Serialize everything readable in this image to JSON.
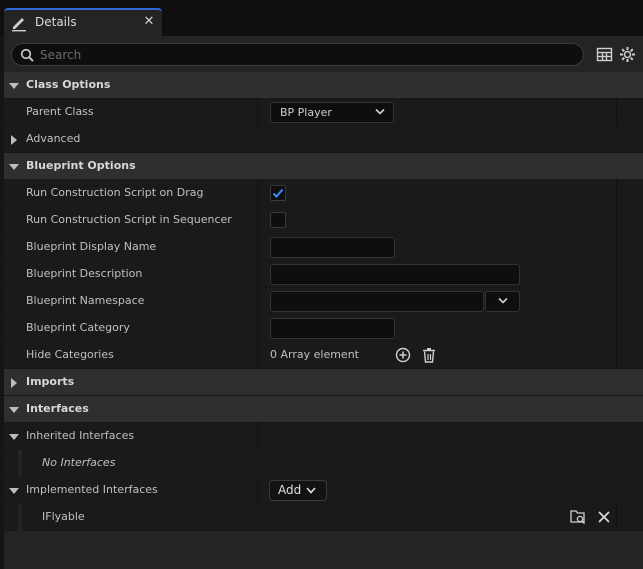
{
  "tab": {
    "title": "Details",
    "close": "✕"
  },
  "search": {
    "placeholder": "Search"
  },
  "sections": {
    "class_options": {
      "label": "Class Options"
    },
    "parent_class": {
      "label": "Parent Class",
      "value": "BP Player"
    },
    "advanced": {
      "label": "Advanced"
    },
    "blueprint_options": {
      "label": "Blueprint Options"
    },
    "run_construction_drag": {
      "label": "Run Construction Script on Drag",
      "checked": true
    },
    "run_construction_sequencer": {
      "label": "Run Construction Script in Sequencer",
      "checked": false
    },
    "display_name": {
      "label": "Blueprint Display Name",
      "value": ""
    },
    "description": {
      "label": "Blueprint Description",
      "value": ""
    },
    "namespace": {
      "label": "Blueprint Namespace",
      "value": ""
    },
    "category": {
      "label": "Blueprint Category",
      "value": ""
    },
    "hide_categories": {
      "label": "Hide Categories",
      "value": "0 Array element"
    },
    "imports": {
      "label": "Imports"
    },
    "interfaces": {
      "label": "Interfaces"
    },
    "inherited_interfaces": {
      "label": "Inherited Interfaces"
    },
    "no_interfaces": {
      "label": "No Interfaces"
    },
    "implemented_interfaces": {
      "label": "Implemented Interfaces",
      "add_label": "Add"
    },
    "iflyable": {
      "label": "IFlyable"
    }
  },
  "colors": {
    "accent": "#2f6bd6",
    "checkmark": "#3a8dff"
  }
}
